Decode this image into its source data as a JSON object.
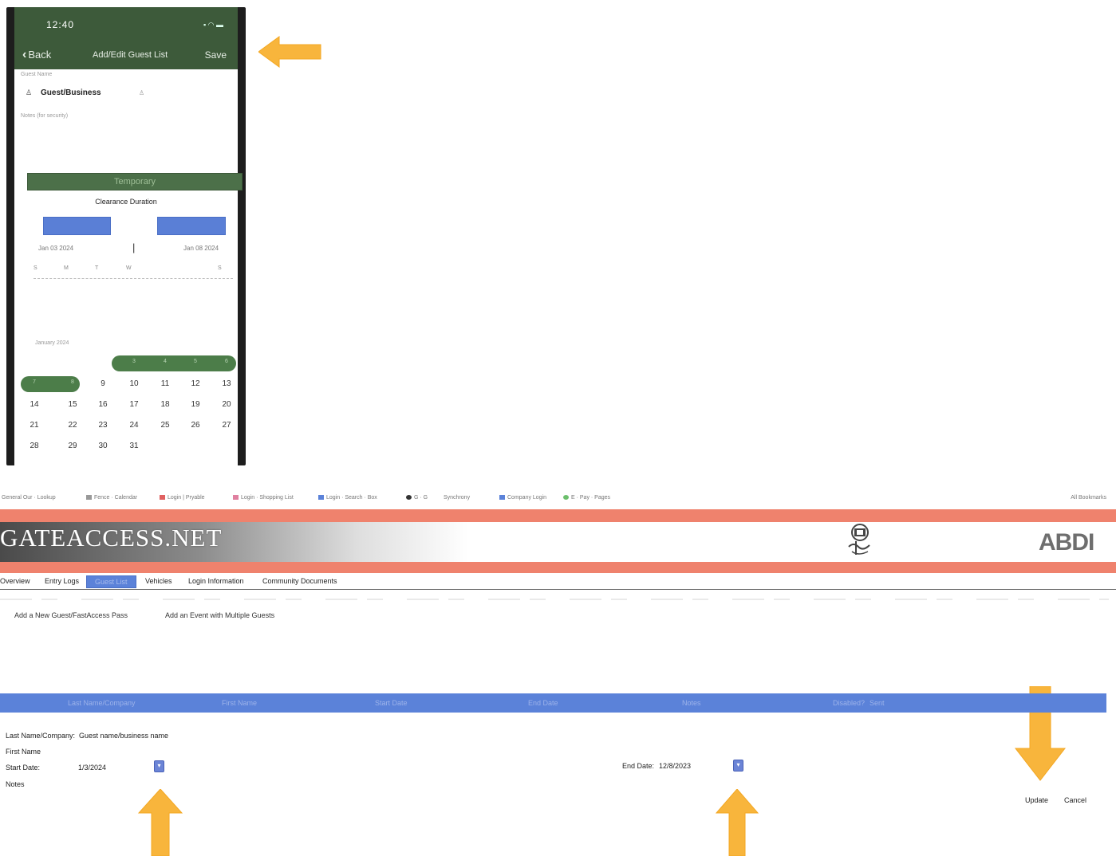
{
  "colors": {
    "phone_header_green": "#3d5a3a",
    "temporary_green": "#4c7049",
    "calendar_pill_green": "#4c7d49",
    "blue_accent": "#5b82d9",
    "salmon_band": "#ef826d",
    "arrow_orange": "#f8b53c"
  },
  "phone": {
    "status_time": "12:40",
    "nav": {
      "back_label": "Back",
      "title": "Add/Edit Guest List",
      "save_label": "Save"
    },
    "guest_name_label": "Guest Name",
    "guest_type": "Guest/Business",
    "notes_placeholder": "Notes (for security)",
    "temporary_label": "Temporary",
    "clearance_duration_label": "Clearance Duration",
    "start_date": "Jan 03 2024",
    "date_separator": "|",
    "end_date": "Jan 08 2024",
    "week_days": [
      "S",
      "M",
      "T",
      "W",
      "",
      "",
      "S"
    ],
    "month_label": "January 2024",
    "calendar_rows": [
      [
        "",
        "",
        "",
        "3",
        "4",
        "5",
        "6"
      ],
      [
        "7",
        "8",
        "9",
        "10",
        "11",
        "12",
        "13"
      ],
      [
        "14",
        "15",
        "16",
        "17",
        "18",
        "19",
        "20"
      ],
      [
        "21",
        "22",
        "23",
        "24",
        "25",
        "26",
        "27"
      ],
      [
        "28",
        "29",
        "30",
        "31",
        "",
        "",
        ""
      ]
    ]
  },
  "browser": {
    "bookmarks": [
      "General Our · Lookup",
      "Fence · Calendar",
      "Login | Pryable",
      "Login · Shopping List",
      "Login · Search · Box",
      "G · G",
      "Synchrony",
      "Company Login",
      "E · Pay · Pages"
    ],
    "bookmarks_right": "All Bookmarks"
  },
  "site": {
    "logo": "GATEACCESS.NET",
    "brand": "ABDI",
    "tabs": [
      "Overview",
      "Entry Logs",
      "Guest List",
      "Vehicles",
      "Login Information",
      "Community Documents"
    ],
    "active_tab": "Guest List",
    "actions": [
      "Add a New Guest/FastAccess Pass",
      "Add an Event with Multiple Guests"
    ],
    "grid_columns": [
      "Last Name/Company",
      "First Name",
      "Start Date",
      "End Date",
      "Notes",
      "Disabled?",
      "Sent"
    ],
    "form": {
      "last_name_label": "Last Name/Company:",
      "last_name_value": "Guest name/business name",
      "first_name_label": "First Name",
      "start_date_label": "Start Date:",
      "start_date_value": "1/3/2024",
      "end_date_label": "End Date:",
      "end_date_value": "12/8/2023",
      "notes_label": "Notes",
      "update_label": "Update",
      "cancel_label": "Cancel"
    }
  }
}
